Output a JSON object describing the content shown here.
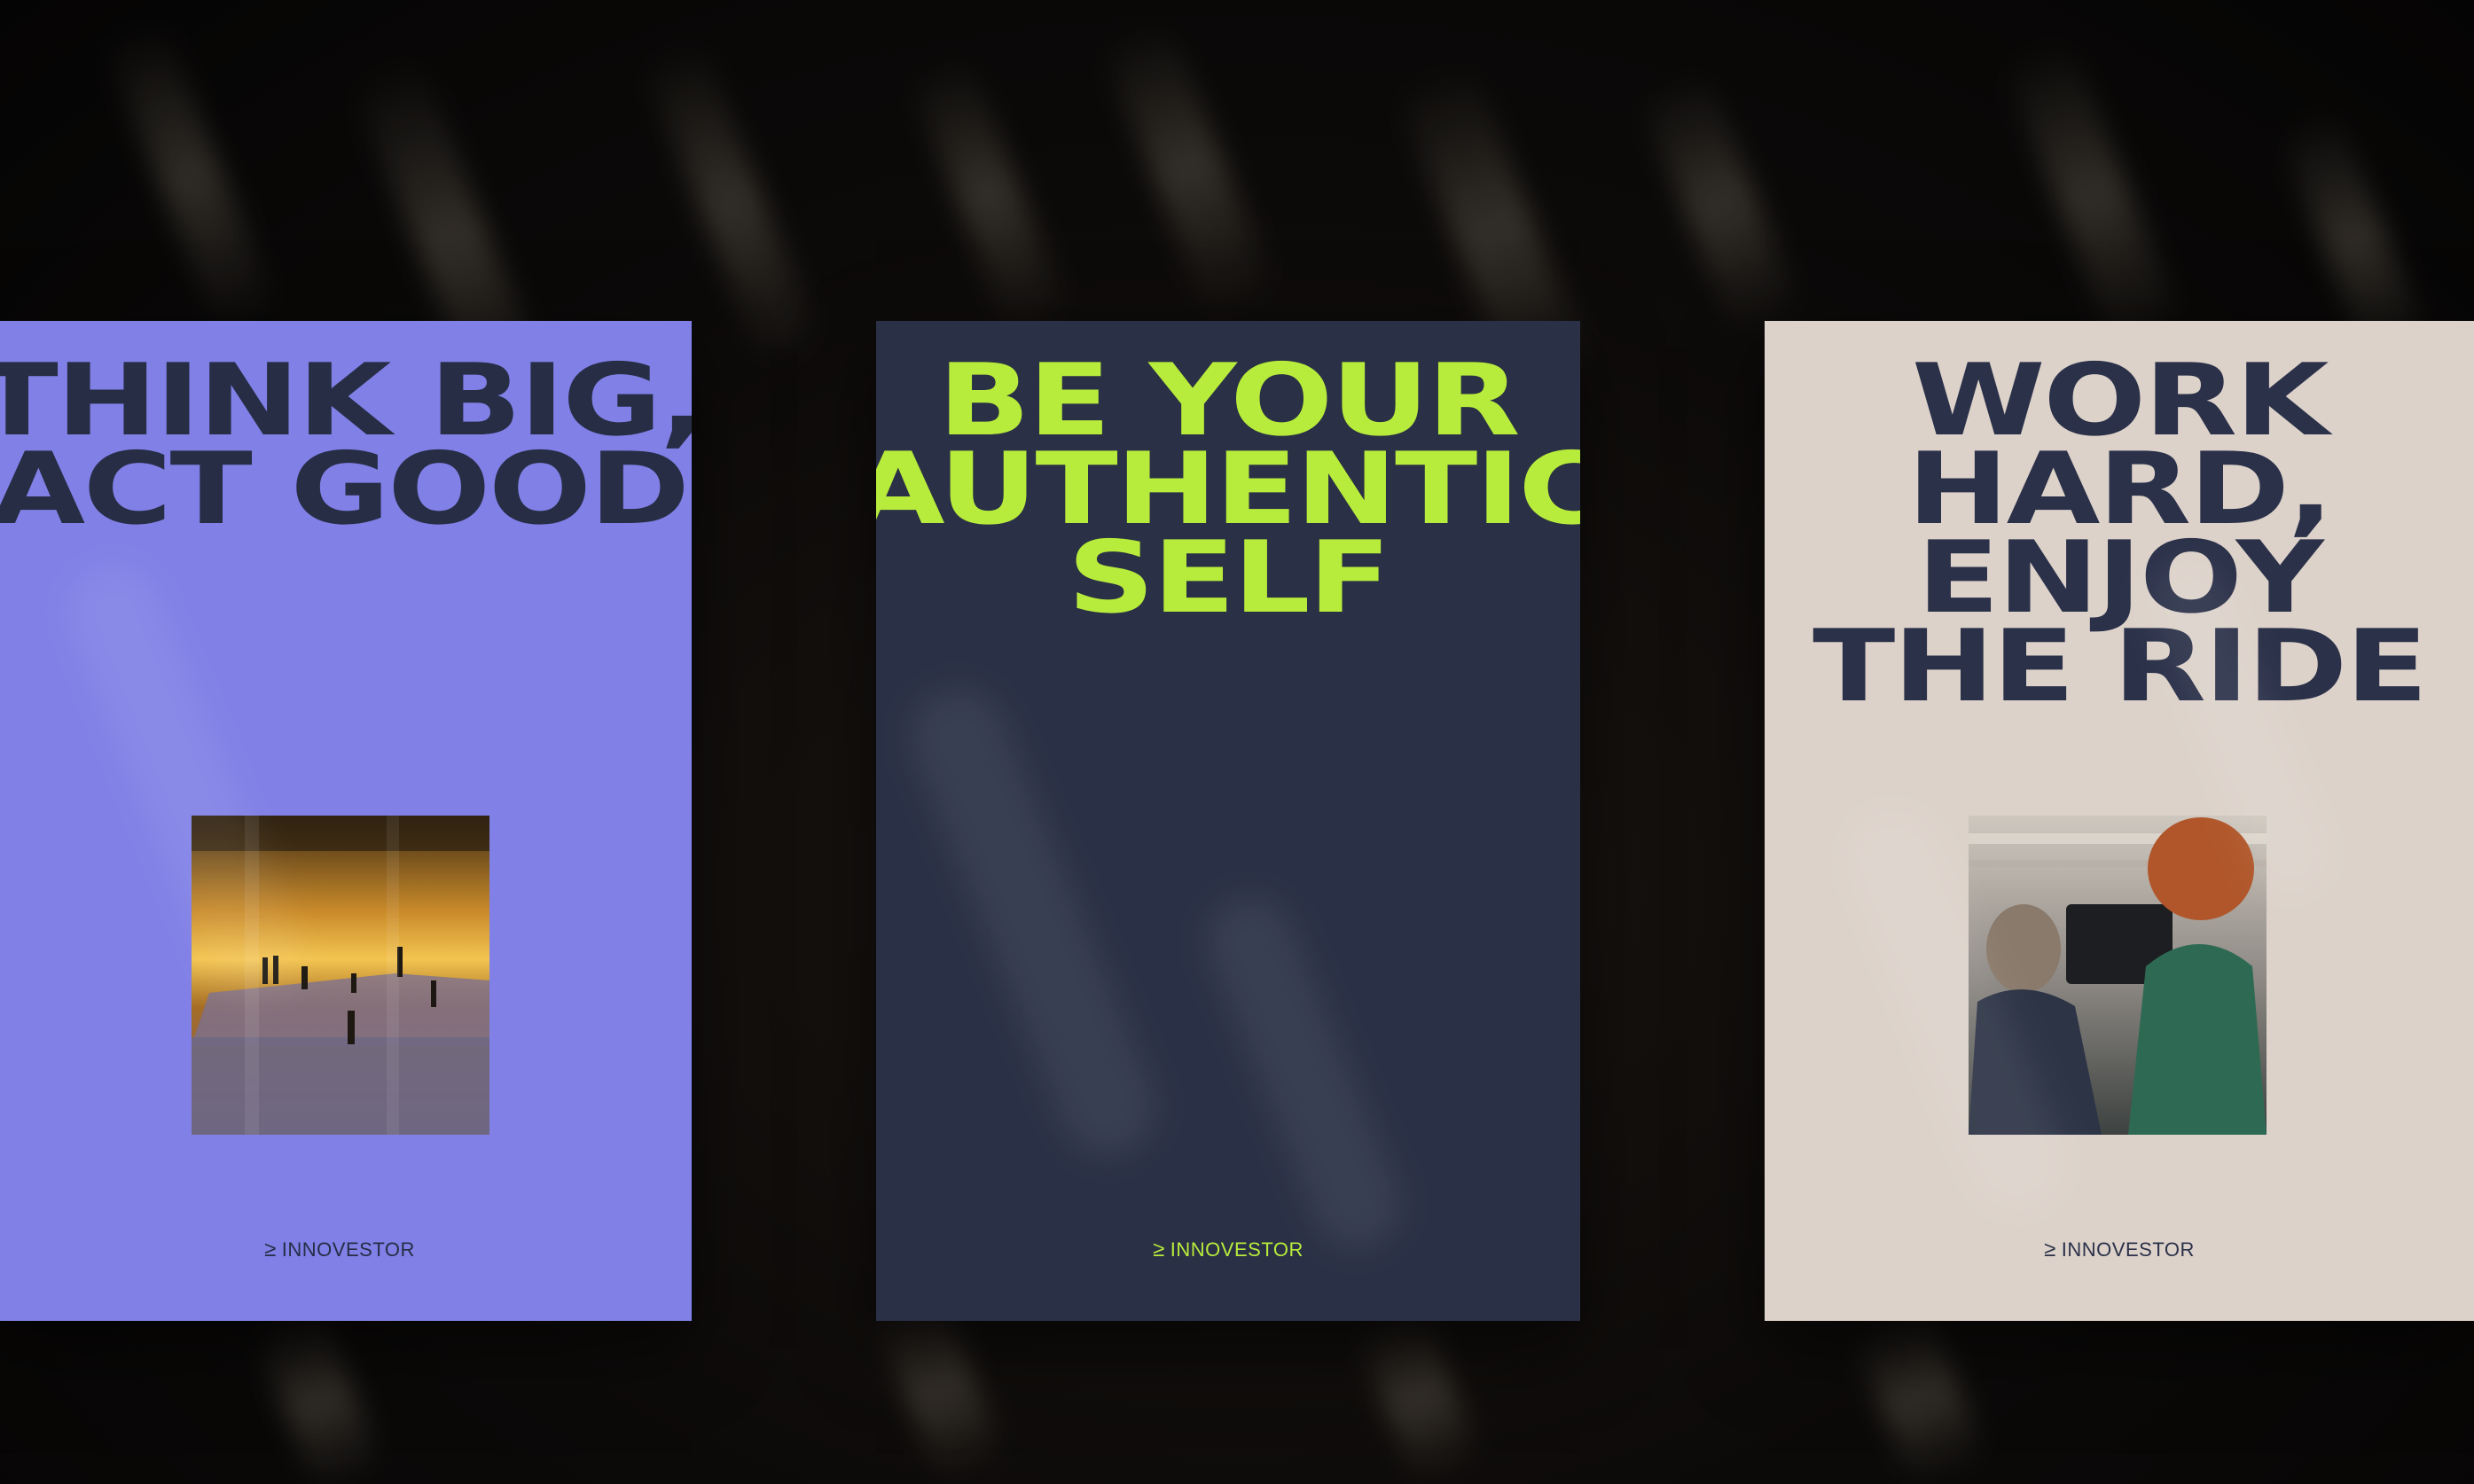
{
  "posters": [
    {
      "headline": [
        "THINK BIG,",
        "ACT GOOD"
      ],
      "brand_mark": "≥",
      "brand": "INNOVESTOR",
      "background": "#8080e6",
      "text_color": "#262d45",
      "photo": "sunset-waterfront-people"
    },
    {
      "headline": [
        "BE YOUR",
        "AUTHENTIC",
        "SELF"
      ],
      "brand_mark": "≥",
      "brand": "INNOVESTOR",
      "background": "#2a3045",
      "text_color": "#b8ec3c"
    },
    {
      "headline": [
        "WORK",
        "HARD,",
        "ENJOY",
        "THE RIDE"
      ],
      "brand_mark": "≥",
      "brand": "INNOVESTOR",
      "background": "#dcd2ca",
      "text_color": "#2b3149",
      "photo": "two-people-with-laptop"
    }
  ]
}
